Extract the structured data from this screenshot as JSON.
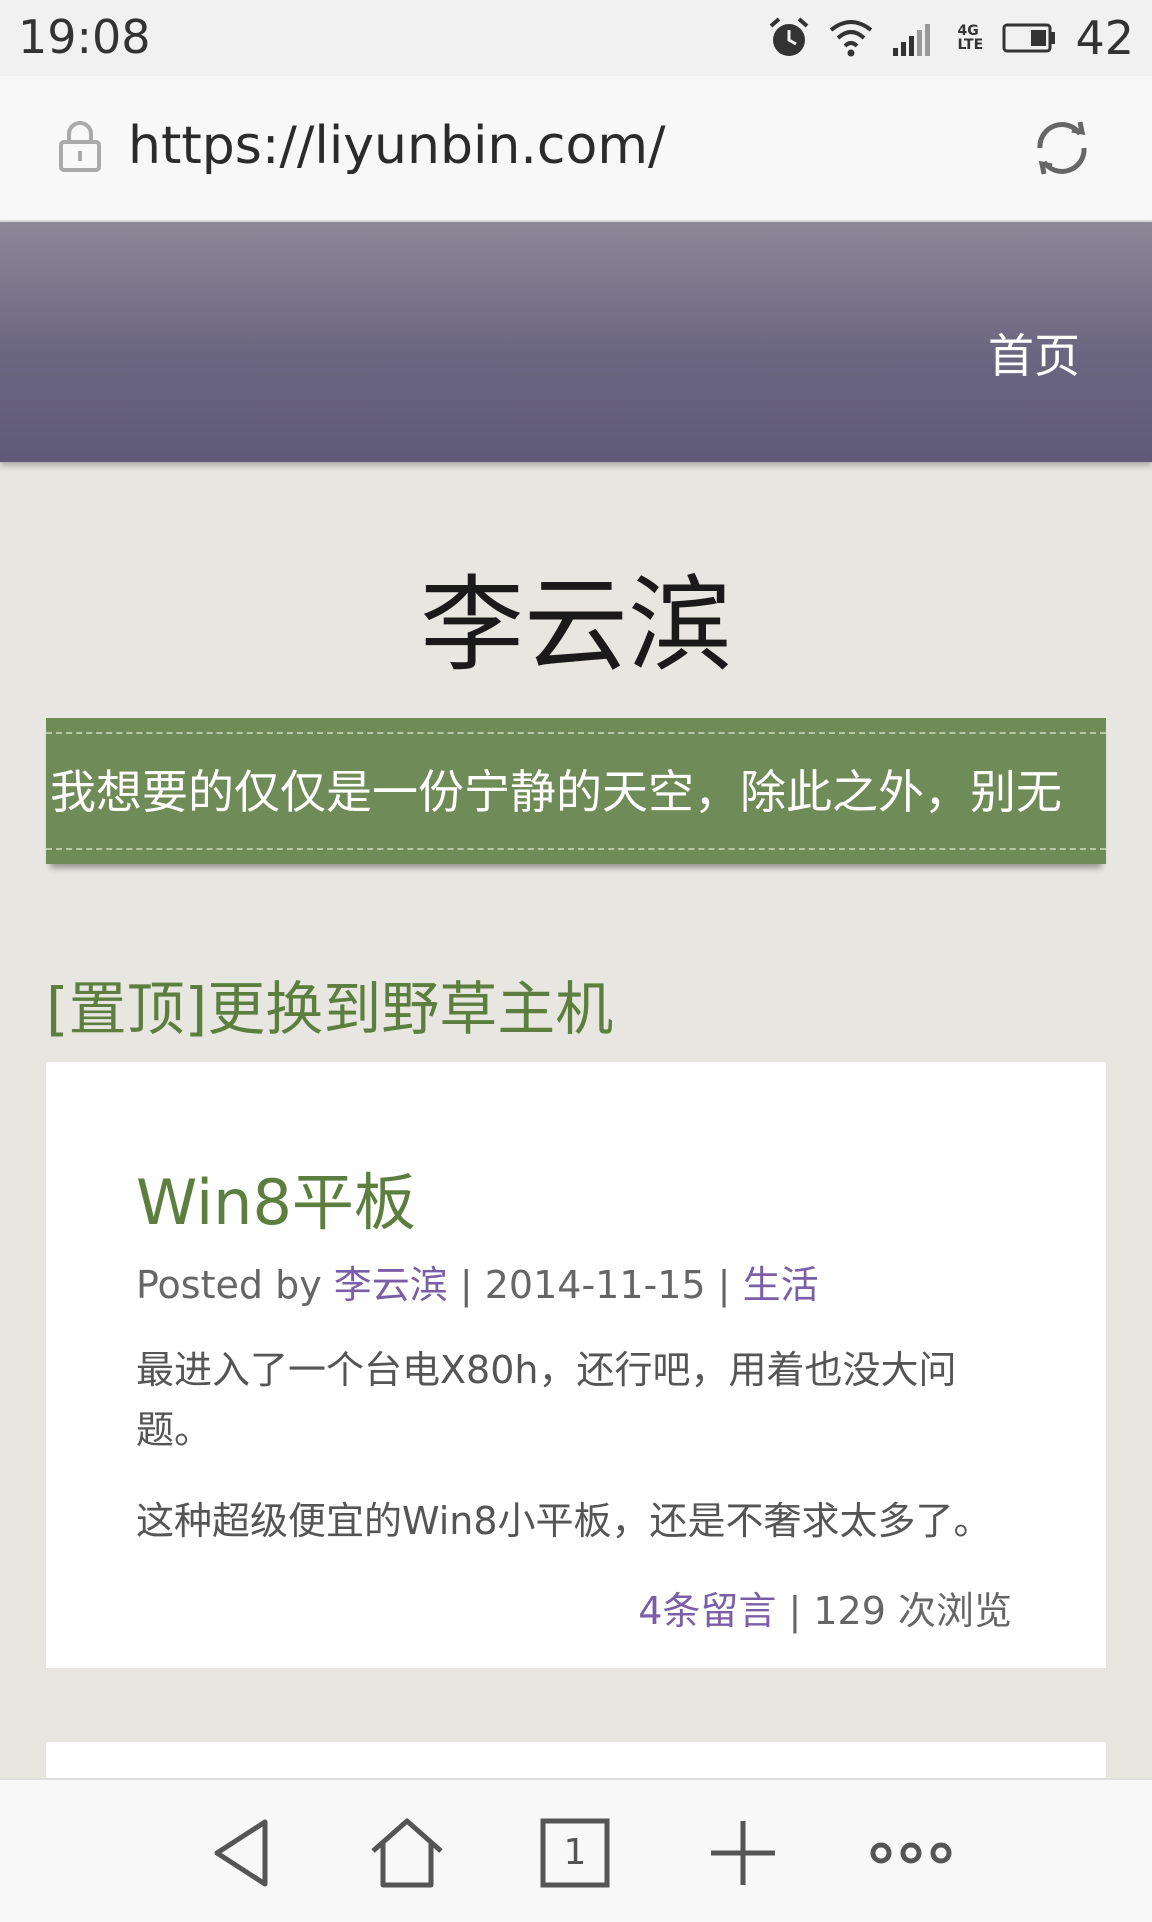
{
  "status_bar": {
    "time": "19:08",
    "network": "4G LTE",
    "battery": "42"
  },
  "browser": {
    "url": "https://liyunbin.com/"
  },
  "site": {
    "nav_home": "首页",
    "title": "李云滨",
    "tagline": "我想要的仅仅是一份宁静的天空，除此之外，别无",
    "sticky_post_title": "[置顶]更换到野草主机"
  },
  "post": {
    "title": "Win8平板",
    "meta_prefix": "Posted by ",
    "author": "李云滨",
    "date": " | 2014-11-15 | ",
    "category": "生活",
    "paragraph1": "最进入了一个台电X80h，还行吧，用着也没大问题。",
    "paragraph2": "这种超级便宜的Win8小平板，还是不奢求太多了。",
    "comments": "4条留言",
    "views": " | 129 次浏览"
  },
  "bottom_nav": {
    "tabs_count": "1"
  }
}
